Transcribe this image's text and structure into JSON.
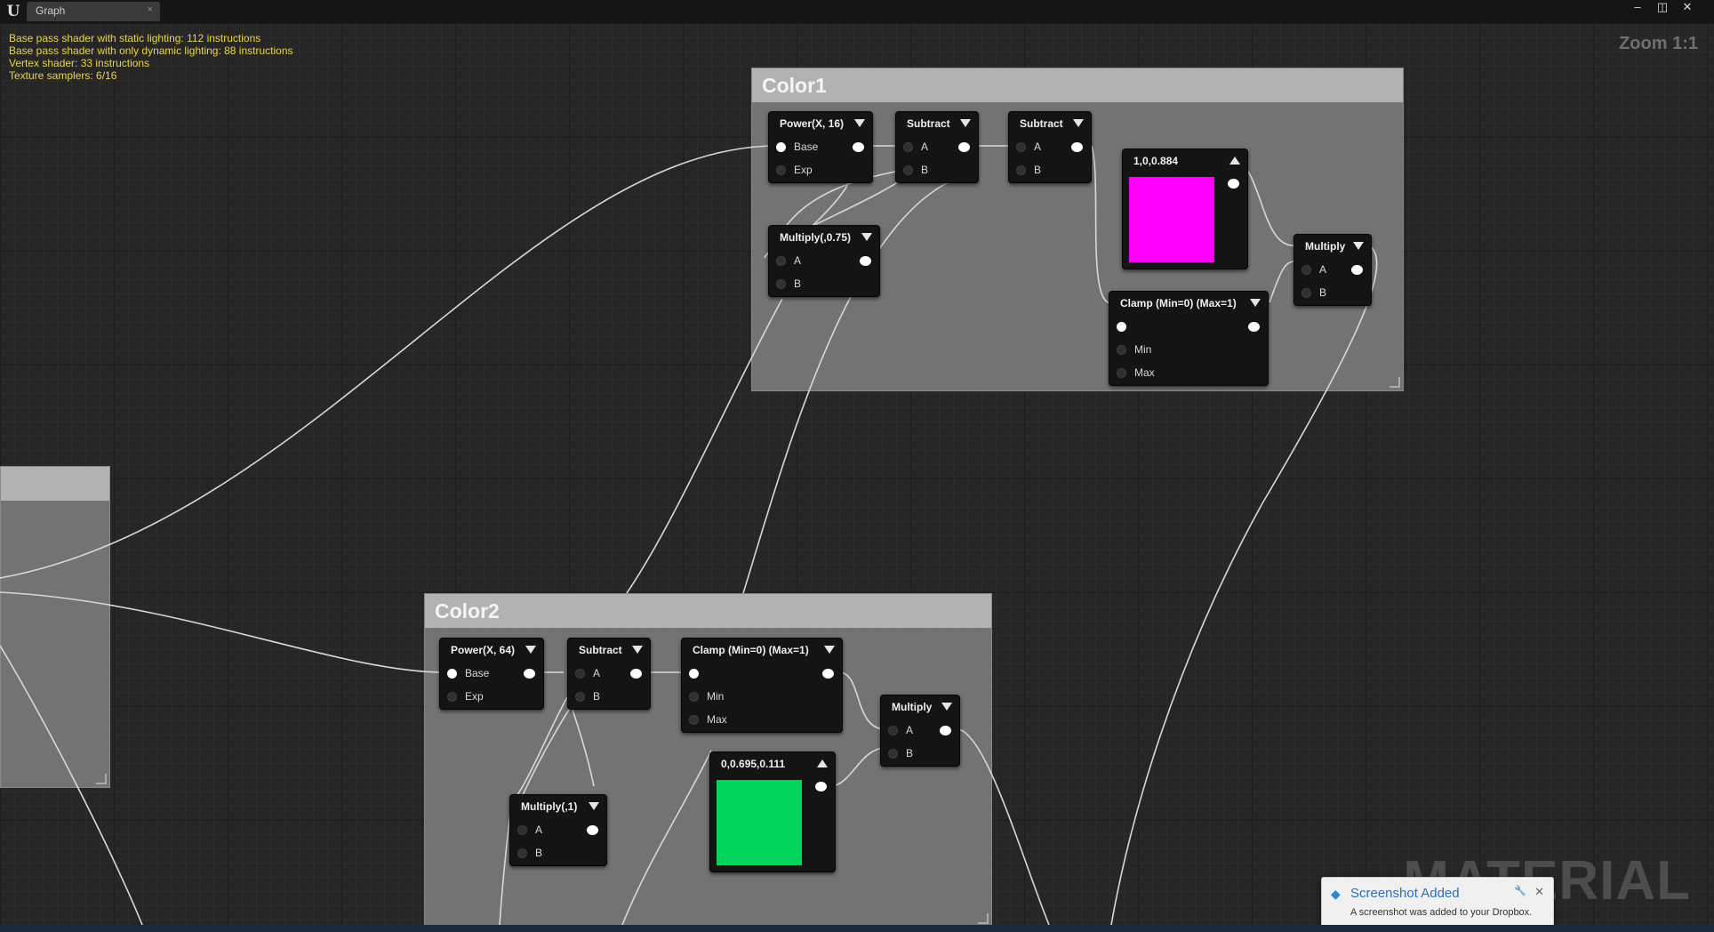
{
  "window": {
    "tab": "Graph",
    "tab_close": "×",
    "logo": "U",
    "controls": [
      "–",
      "◫",
      "✕"
    ]
  },
  "stats": [
    "Base pass shader with static lighting: 112 instructions",
    "Base pass shader with only dynamic lighting: 88 instructions",
    "Vertex shader: 33 instructions",
    "Texture samplers: 6/16"
  ],
  "zoom": "Zoom 1:1",
  "watermark": "MATERIAL",
  "comments": {
    "color1": "Color1",
    "color2": "Color2",
    "left": ""
  },
  "nodes": {
    "power16": {
      "title": "Power(X, 16)",
      "pins": [
        "Base",
        "Exp"
      ]
    },
    "sub1a": {
      "title": "Subtract",
      "pins": [
        "A",
        "B"
      ]
    },
    "sub1b": {
      "title": "Subtract",
      "pins": [
        "A",
        "B"
      ]
    },
    "mult075": {
      "title": "Multiply(,0.75)",
      "pins": [
        "A",
        "B"
      ]
    },
    "const_magenta": {
      "title": "1,0,0.884",
      "color": "#ff00ff"
    },
    "clamp1": {
      "title": "Clamp (Min=0) (Max=1)",
      "pins": [
        "",
        "Min",
        "Max"
      ]
    },
    "mult1": {
      "title": "Multiply",
      "pins": [
        "A",
        "B"
      ]
    },
    "power64": {
      "title": "Power(X, 64)",
      "pins": [
        "Base",
        "Exp"
      ]
    },
    "sub2": {
      "title": "Subtract",
      "pins": [
        "A",
        "B"
      ]
    },
    "clamp2": {
      "title": "Clamp (Min=0) (Max=1)",
      "pins": [
        "",
        "Min",
        "Max"
      ]
    },
    "mult2": {
      "title": "Multiply",
      "pins": [
        "A",
        "B"
      ]
    },
    "mult1c": {
      "title": "Multiply(,1)",
      "pins": [
        "A",
        "B"
      ]
    },
    "const_green": {
      "title": "0,0.695,0.111",
      "color": "#00d45a"
    }
  },
  "toast": {
    "title": "Screenshot Added",
    "body": "A screenshot was added to your Dropbox.",
    "close": "✕",
    "pin": "🔧"
  }
}
